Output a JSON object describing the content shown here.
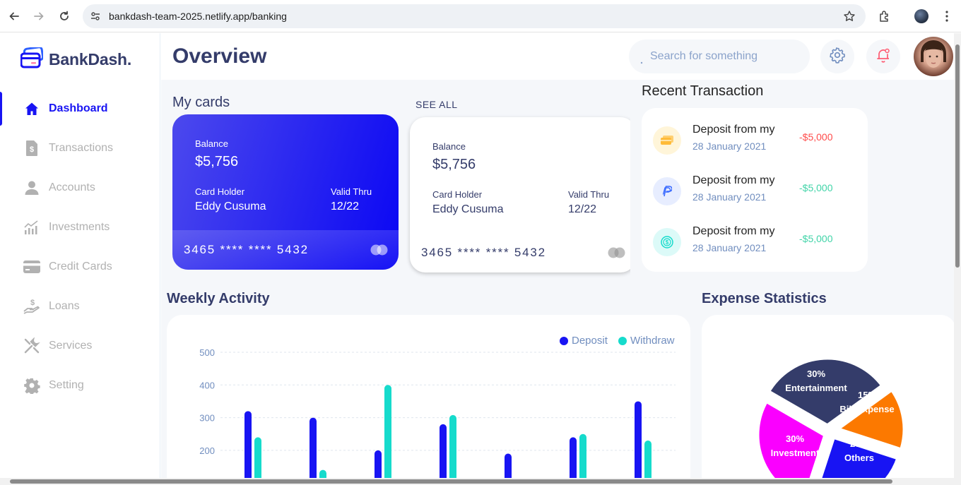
{
  "browser": {
    "url": "bankdash-team-2025.netlify.app/banking"
  },
  "brand": {
    "name": "BankDash."
  },
  "sidebar": {
    "items": [
      {
        "label": "Dashboard",
        "icon": "home-icon",
        "active": true
      },
      {
        "label": "Transactions",
        "icon": "transactions-icon",
        "active": false
      },
      {
        "label": "Accounts",
        "icon": "user-icon",
        "active": false
      },
      {
        "label": "Investments",
        "icon": "investments-icon",
        "active": false
      },
      {
        "label": "Credit Cards",
        "icon": "credit-card-icon",
        "active": false
      },
      {
        "label": "Loans",
        "icon": "loan-icon",
        "active": false
      },
      {
        "label": "Services",
        "icon": "services-icon",
        "active": false
      },
      {
        "label": "Setting",
        "icon": "gear-icon",
        "active": false
      }
    ]
  },
  "header": {
    "title": "Overview",
    "search_placeholder": "Search for something"
  },
  "cards_section": {
    "title": "My cards",
    "see_all": "SEE ALL",
    "cards": [
      {
        "balance_label": "Balance",
        "balance": "$5,756",
        "holder_label": "Card Holder",
        "holder": "Eddy Cusuma",
        "valid_label": "Valid Thru",
        "valid": "12/22",
        "number": "3465 **** **** 5432"
      },
      {
        "balance_label": "Balance",
        "balance": "$5,756",
        "holder_label": "Card Holder",
        "holder": "Eddy Cusuma",
        "valid_label": "Valid Thru",
        "valid": "12/22",
        "number": "3465 **** **** 5432"
      }
    ]
  },
  "transactions": {
    "title": "Recent Transaction",
    "items": [
      {
        "title": "Deposit from my",
        "date": "28 January 2021",
        "amount": "-$5,000",
        "icon": "card-icon"
      },
      {
        "title": "Deposit from my",
        "date": "28 January 2021",
        "amount": "-$5,000",
        "icon": "paypal-icon"
      },
      {
        "title": "Deposit from my",
        "date": "28 January 2021",
        "amount": "-$5,000",
        "icon": "dollar-coin-icon"
      }
    ]
  },
  "weekly": {
    "title": "Weekly Activity"
  },
  "expense": {
    "title": "Expense Statistics"
  },
  "colors": {
    "primary": "#1814F3",
    "teal": "#16DBCC",
    "text_dark": "#343C6A",
    "muted": "#718EBF",
    "negative": "#FF4B4A",
    "positive": "#41D4A8"
  },
  "chart_data": [
    {
      "type": "bar",
      "title": "Weekly Activity",
      "categories": [
        "",
        "",
        "",
        "",
        "",
        "",
        ""
      ],
      "series": [
        {
          "name": "Deposit",
          "values": [
            320,
            300,
            200,
            280,
            190,
            240,
            350
          ]
        },
        {
          "name": "Withdraw",
          "values": [
            240,
            140,
            400,
            308,
            0,
            250,
            230
          ]
        }
      ],
      "yticks": [
        500,
        400,
        300,
        200
      ],
      "ylim": [
        100,
        500
      ],
      "legend": "top-right",
      "grid": true
    },
    {
      "type": "pie",
      "title": "Expense Statistics",
      "slices": [
        {
          "label": "Entertainment",
          "value": 30,
          "pct": "30%",
          "color": "#343C6A"
        },
        {
          "label": "Bill Expense",
          "value": 15,
          "pct": "15%",
          "color": "#FC7900"
        },
        {
          "label": "Others",
          "value": 25,
          "pct": "25%",
          "color": "#1814F3"
        },
        {
          "label": "Investment",
          "value": 30,
          "pct": "30%",
          "color": "#FA00FF"
        }
      ]
    }
  ]
}
